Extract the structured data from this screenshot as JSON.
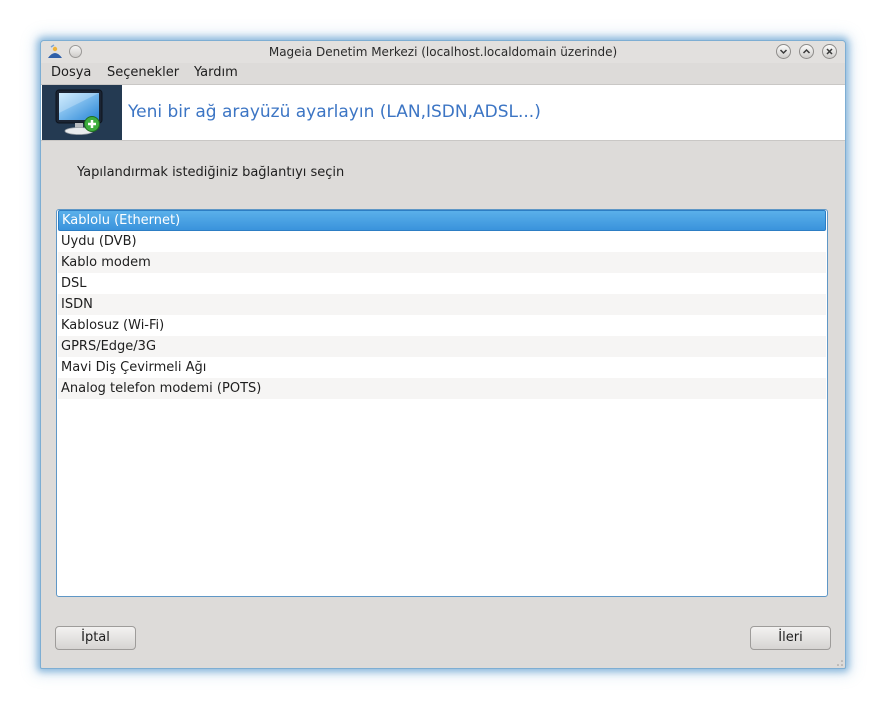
{
  "window": {
    "title": "Mageia Denetim Merkezi  (localhost.localdomain üzerinde)",
    "accent_color": "#498fc9"
  },
  "menu": {
    "items": [
      {
        "label": "Dosya"
      },
      {
        "label": "Seçenekler"
      },
      {
        "label": "Yardım"
      }
    ]
  },
  "banner": {
    "icon": "monitor-add-icon",
    "title": "Yeni bir ağ arayüzü ayarlayın (LAN,ISDN,ADSL...)",
    "title_color": "#3c75c4"
  },
  "content": {
    "prompt": "Yapılandırmak istediğiniz bağlantıyı seçin",
    "connection_types": [
      {
        "label": "Kablolu (Ethernet)",
        "selected": true
      },
      {
        "label": "Uydu (DVB)"
      },
      {
        "label": "Kablo modem"
      },
      {
        "label": "DSL"
      },
      {
        "label": "ISDN"
      },
      {
        "label": "Kablosuz (Wi-Fi)"
      },
      {
        "label": "GPRS/Edge/3G"
      },
      {
        "label": "Mavi Diş Çevirmeli Ağı"
      },
      {
        "label": "Analog telefon modemi (POTS)"
      }
    ],
    "selection_color": "#3a93dc"
  },
  "buttons": {
    "cancel": "İptal",
    "next": "İleri"
  }
}
